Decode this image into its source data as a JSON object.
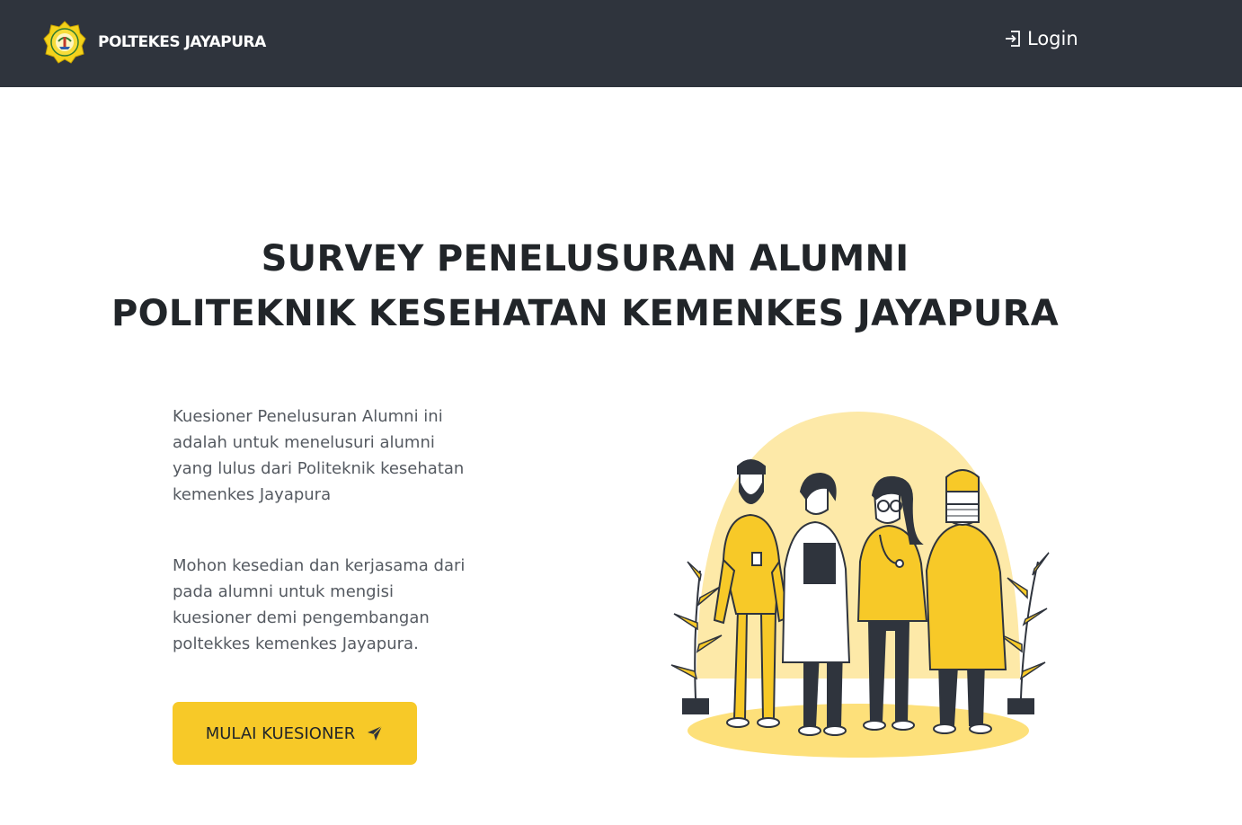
{
  "navbar": {
    "brand_name": "POLTEKES JAYAPURA",
    "login_label": "Login",
    "logo_icon": "institution-emblem",
    "login_icon": "login-icon",
    "background_color": "#2f343d"
  },
  "hero": {
    "title_line1": "SURVEY PENELUSURAN ALUMNI",
    "title_line2": "POLITEKNIK KESEHATAN KEMENKES JAYAPURA"
  },
  "content": {
    "paragraph1": "Kuesioner Penelusuran Alumni ini adalah untuk menelusuri alumni yang lulus dari Politeknik kesehatan kemenkes Jayapura",
    "paragraph2": "Mohon kesedian dan kerjasama dari pada alumni untuk mengisi kuesioner demi pengembangan poltekkes kemenkes Jayapura.",
    "cta_label": "MULAI KUESIONER",
    "cta_icon": "send-icon",
    "accent_color": "#f7c928"
  },
  "illustration": {
    "subject": "health-workers-illustration"
  }
}
